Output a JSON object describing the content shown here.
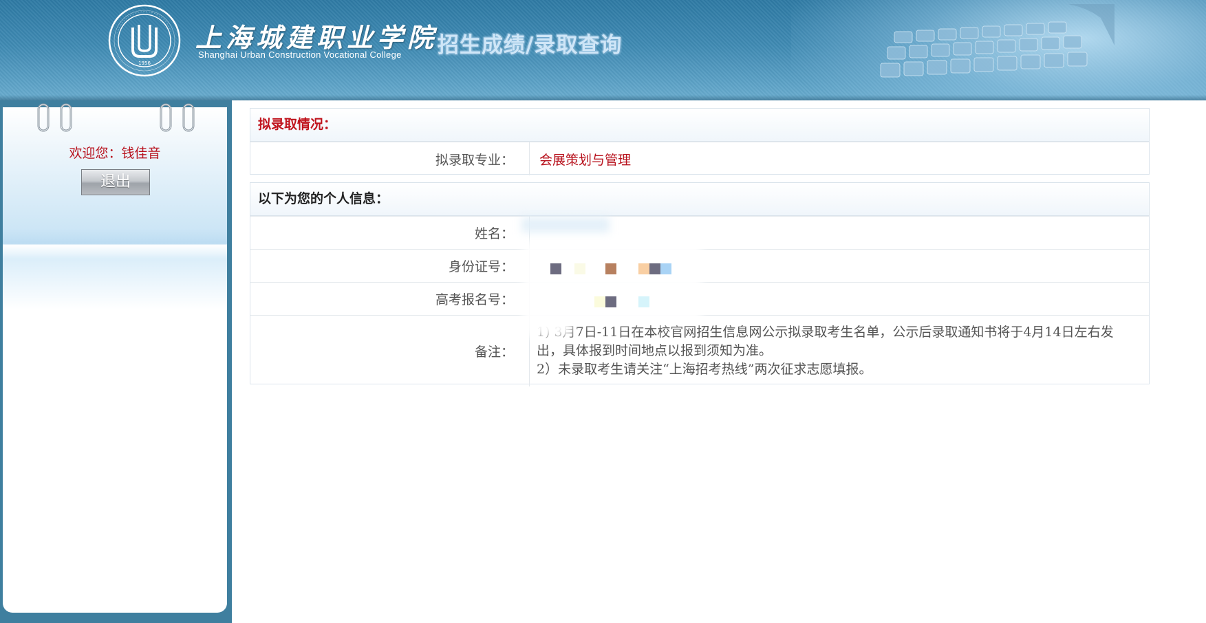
{
  "header": {
    "college_name_cn": "上海城建职业学院",
    "college_name_en": "Shanghai Urban Construction Vocational College",
    "seal_year": "1956",
    "page_heading": "招生成绩/录取查询"
  },
  "sidebar": {
    "welcome_label": "欢迎您：钱佳音",
    "logout_label": "退出"
  },
  "admission": {
    "heading": "拟录取情况：",
    "heading_color": "#c0141d",
    "major_label": "拟录取专业：",
    "major_value": "会展策划与管理",
    "major_color": "#b8131e"
  },
  "personal": {
    "heading": "以下为您的个人信息：",
    "name_label": "姓名：",
    "id_label": "身份证号：",
    "exam_no_label": "高考报名号：",
    "remarks_label": "备注：",
    "remarks_line1": "1) 3月7日-11日在本校官网招生信息网公示拟录取考生名单，公示后录取通知书将于4月14日左右发出，具体报到时间地点以报到须知为准。",
    "remarks_line2": "2）未录取考生请关注“上海招考热线”两次征求志愿填报。"
  }
}
